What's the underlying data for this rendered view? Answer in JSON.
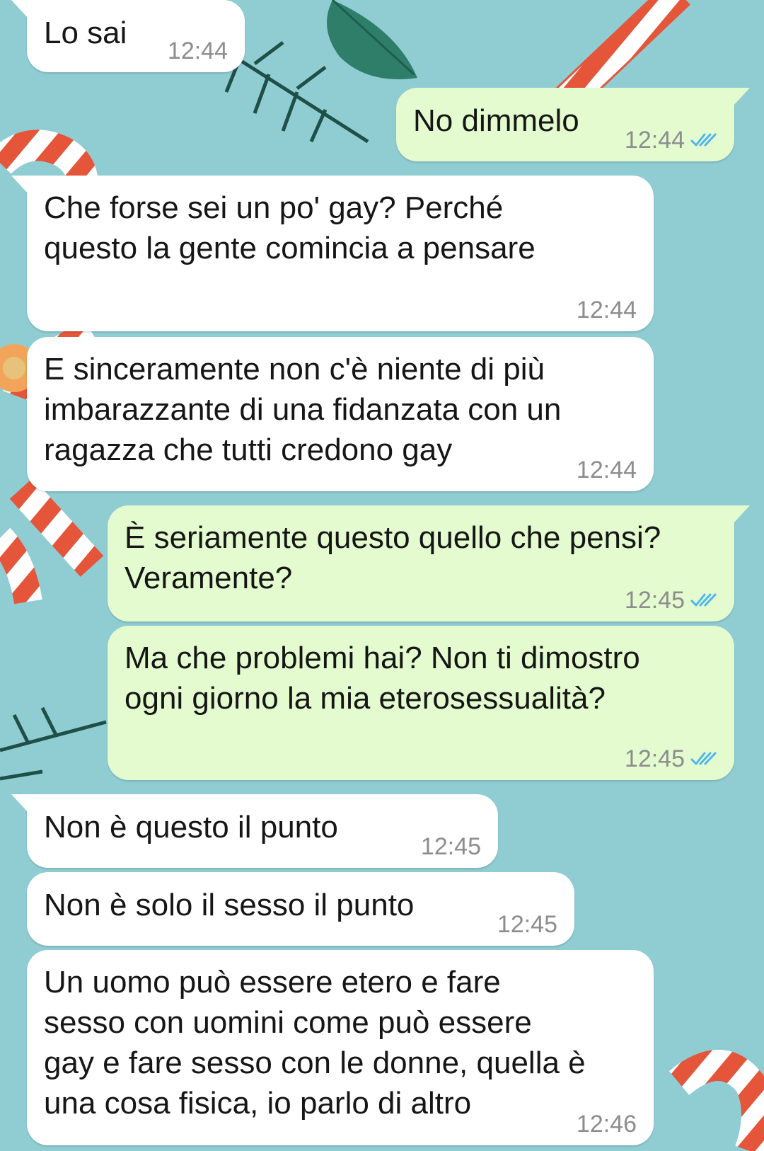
{
  "chat": {
    "messages": [
      {
        "direction": "in",
        "text": "Lo sai",
        "time": "12:44"
      },
      {
        "direction": "out",
        "text": "No dimmelo",
        "time": "12:44",
        "status": "read"
      },
      {
        "direction": "in",
        "text": "Che forse sei un po' gay? Perché\nquesto la gente comincia a pensare",
        "time": "12:44"
      },
      {
        "direction": "in",
        "text": "E sinceramente non c'è niente di più\nimbarazzante di una fidanzata con un\nragazza che tutti credono gay",
        "time": "12:44"
      },
      {
        "direction": "out",
        "text": "È seriamente questo quello che pensi?\nVeramente?",
        "time": "12:45",
        "status": "read"
      },
      {
        "direction": "out",
        "text": "Ma che problemi hai? Non ti dimostro\nogni giorno la mia eterosessualità?",
        "time": "12:45",
        "status": "read"
      },
      {
        "direction": "in",
        "text": "Non è questo il punto",
        "time": "12:45"
      },
      {
        "direction": "in",
        "text": "Non è solo il sesso il punto",
        "time": "12:45"
      },
      {
        "direction": "in",
        "text": "Un uomo può essere etero e fare\nsesso con uomini come può essere\ngay e fare sesso con le donne, quella è\nuna cosa fisica, io parlo di altro",
        "time": "12:46"
      }
    ]
  },
  "icons": {
    "read_receipt": "double-check-icon"
  },
  "colors": {
    "wallpaper": "#8fcdd3",
    "incoming_bubble": "#ffffff",
    "outgoing_bubble": "#e3fbcf",
    "timestamp": "#8d8d8d",
    "read_ticks": "#4fb6ec"
  }
}
